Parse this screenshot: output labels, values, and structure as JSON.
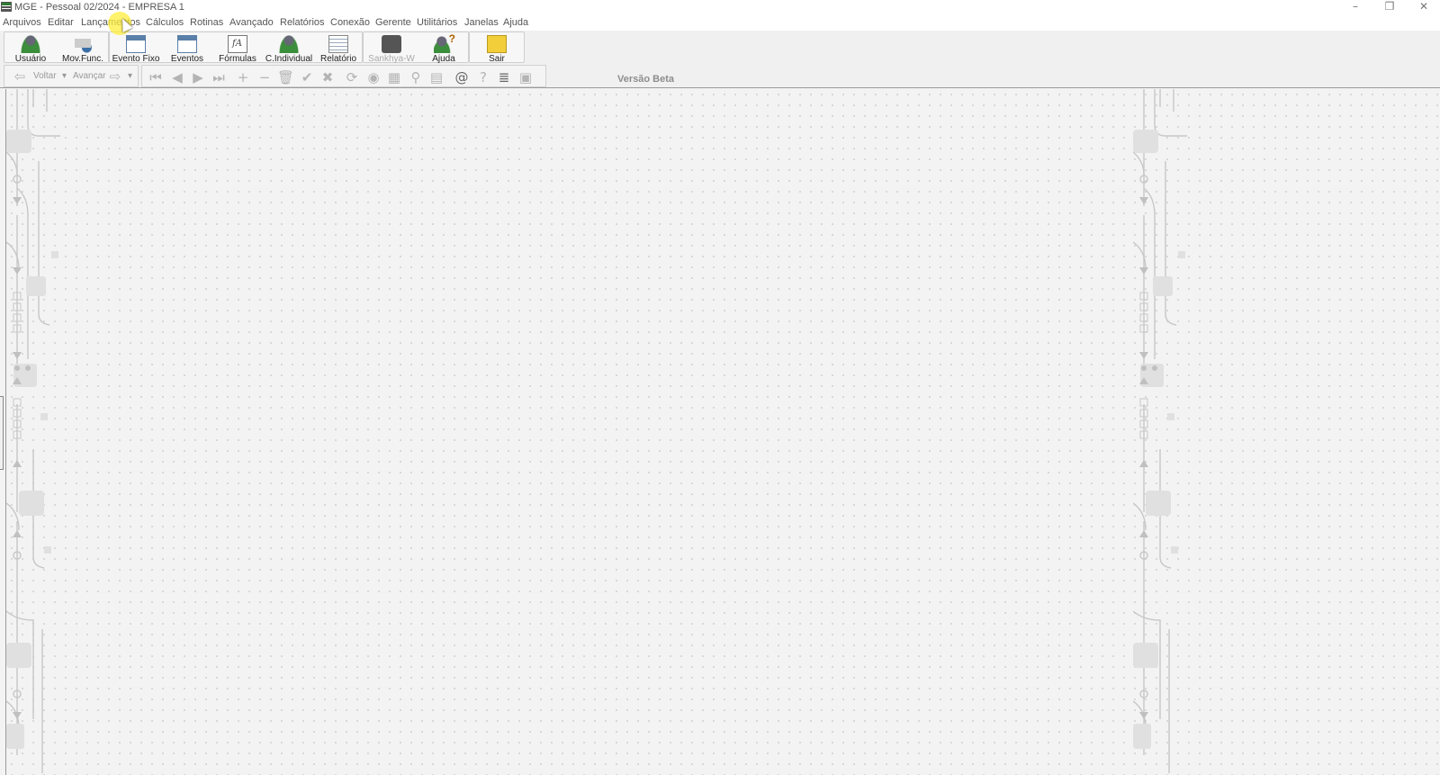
{
  "window": {
    "title": "MGE - Pessoal 02/2024 - EMPRESA 1",
    "controls": {
      "minimize": "–",
      "maximize": "❐",
      "close": "✕"
    }
  },
  "menu": {
    "items": [
      "Arquivos",
      "Editar",
      "Lançamentos",
      "Cálculos",
      "Rotinas",
      "Avançado",
      "Relatórios",
      "Conexão",
      "Gerente",
      "Utilitários",
      "Janelas",
      "Ajuda"
    ]
  },
  "toolbar": {
    "buttons": [
      {
        "label": "Usuário",
        "icon": "user-icon"
      },
      {
        "label": "Mov.Func.",
        "icon": "employee-movement-icon"
      },
      {
        "label": "Evento Fixo",
        "icon": "fixed-event-calendar-icon"
      },
      {
        "label": "Eventos",
        "icon": "events-calendar-icon"
      },
      {
        "label": "Fórmulas",
        "icon": "formula-icon"
      },
      {
        "label": "C.Individual",
        "icon": "individual-calc-icon"
      },
      {
        "label": "Relatório",
        "icon": "report-icon"
      },
      {
        "label": "Sankhya-W",
        "icon": "sankhya-logo-icon"
      },
      {
        "label": "Ajuda",
        "icon": "help-user-icon"
      },
      {
        "label": "Sair",
        "icon": "exit-door-icon"
      }
    ]
  },
  "navbar": {
    "back_label": "Voltar",
    "forward_label": "Avançar",
    "tools": [
      {
        "icon": "first-record-icon",
        "glyph": "⏮"
      },
      {
        "icon": "previous-record-icon",
        "glyph": "◀"
      },
      {
        "icon": "next-record-icon",
        "glyph": "▶"
      },
      {
        "icon": "last-record-icon",
        "glyph": "⏭"
      },
      {
        "icon": "add-icon",
        "glyph": "+"
      },
      {
        "icon": "remove-icon",
        "glyph": "−"
      },
      {
        "icon": "delete-icon",
        "glyph": "🗑"
      },
      {
        "icon": "confirm-icon",
        "glyph": "✔"
      },
      {
        "icon": "cancel-icon",
        "glyph": "✖"
      },
      {
        "icon": "refresh-icon",
        "glyph": "⟳"
      },
      {
        "icon": "disk-icon",
        "glyph": "◉"
      },
      {
        "icon": "grid-icon",
        "glyph": "▦"
      },
      {
        "icon": "search-icon",
        "glyph": "⚲"
      },
      {
        "icon": "print-icon",
        "glyph": "▤"
      },
      {
        "icon": "email-icon",
        "glyph": "@"
      },
      {
        "icon": "help-icon",
        "glyph": "?"
      },
      {
        "icon": "wrap-text-icon",
        "glyph": "≣"
      },
      {
        "icon": "camera-icon",
        "glyph": "▣"
      }
    ]
  },
  "status": {
    "beta_label": "Versão Beta"
  }
}
